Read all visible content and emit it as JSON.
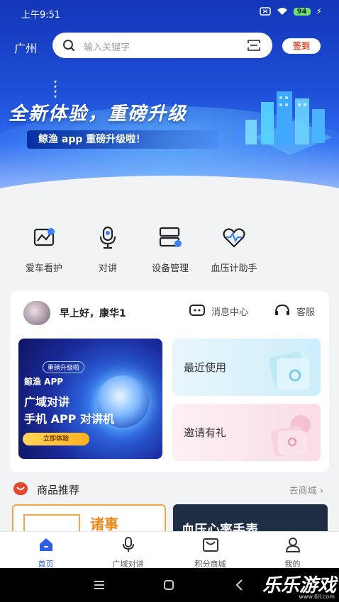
{
  "statusbar": {
    "time": "上午9:51",
    "battery": "94"
  },
  "header": {
    "city": "广州",
    "search_placeholder": "输入关键字",
    "signin_label": "签到"
  },
  "banner": {
    "title": "全新体验，重磅升级",
    "subtitle": "鲸渔 app 重磅升级啦！"
  },
  "quicknav": [
    {
      "label": "爱车看护",
      "icon": "car-flag-icon"
    },
    {
      "label": "对讲",
      "icon": "microphone-icon"
    },
    {
      "label": "设备管理",
      "icon": "device-manage-icon"
    },
    {
      "label": "血压计助手",
      "icon": "heart-pulse-icon"
    }
  ],
  "card": {
    "greeting": "早上好，康华1",
    "message_center": "消息中心",
    "customer_service": "客服",
    "promo": {
      "tag": "重磅升级啦",
      "line1": "鲸渔 APP",
      "line2": "广域对讲",
      "line3": "手机 APP 对讲机",
      "button": "立即体验"
    },
    "recent_label": "最近使用",
    "invite_label": "邀请有礼"
  },
  "products": {
    "title": "商品推荐",
    "more": "去商城 ›",
    "card1_text": "诸事",
    "card2_text": "血压心率手表"
  },
  "tabbar": [
    {
      "label": "首页",
      "icon": "home-icon",
      "active": true
    },
    {
      "label": "广域对讲",
      "icon": "microphone-icon",
      "active": false
    },
    {
      "label": "积分商城",
      "icon": "mall-bag-icon",
      "active": false
    },
    {
      "label": "我的",
      "icon": "user-icon",
      "active": false
    }
  ],
  "watermark": {
    "text": "乐乐游戏",
    "url": "www.6ll.com"
  },
  "colors": {
    "primary": "#2c5fe6",
    "signin": "#e5492d",
    "hero": "#1d4fd6"
  }
}
